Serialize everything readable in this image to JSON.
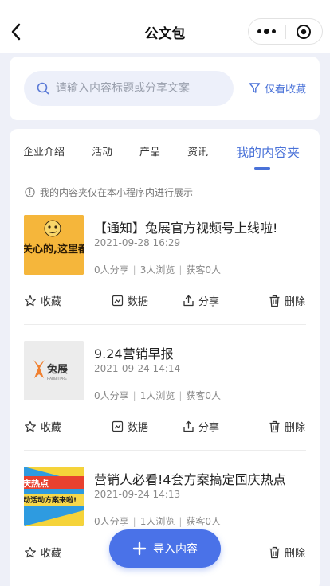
{
  "header": {
    "title": "公文包",
    "back_icon": "chevron-left-icon",
    "menu_icon": "more-dots-icon",
    "close_icon": "target-circle-icon"
  },
  "search": {
    "placeholder": "请输入内容标题或分享文案",
    "filter_label": "仅看收藏"
  },
  "tabs": [
    {
      "label": "企业介绍",
      "active": false
    },
    {
      "label": "活动",
      "active": false
    },
    {
      "label": "产品",
      "active": false
    },
    {
      "label": "资讯",
      "active": false
    },
    {
      "label": "我的内容夹",
      "active": true
    }
  ],
  "notice": "我的内容夹仅在本小程序内进行展示",
  "thumb_texts": {
    "t1": "关心的,这里都",
    "t2_brand": "兔展",
    "t2_sub": "RABBITPRE",
    "t3_top": "庆热点",
    "t3_bottom": "动活动方案来啦!"
  },
  "items": [
    {
      "title": "【通知】兔展官方视频号上线啦!",
      "time": "2021-09-28 16:29",
      "shares": "0人分享",
      "views": "3人浏览",
      "leads": "获客0人"
    },
    {
      "title": "9.24营销早报",
      "time": "2021-09-24 14:14",
      "shares": "0人分享",
      "views": "1人浏览",
      "leads": "获客0人"
    },
    {
      "title": "营销人必看!4套方案搞定国庆热点",
      "time": "2021-09-24 14:13",
      "shares": "0人分享",
      "views": "1人浏览",
      "leads": "获客0人"
    }
  ],
  "actions": {
    "favorite": "收藏",
    "data": "数据",
    "share": "分享",
    "delete": "删除"
  },
  "fab": {
    "label": "导入内容"
  },
  "colors": {
    "accent": "#4a72d8",
    "background": "#eef0f8",
    "fab": "#4a72e8"
  }
}
